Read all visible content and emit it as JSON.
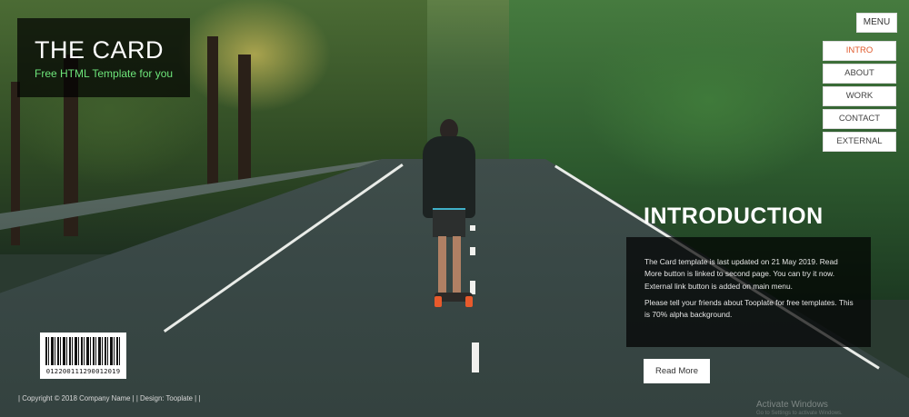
{
  "brand": {
    "title": "THE CARD",
    "subtitle": "Free HTML Template for you"
  },
  "menu": {
    "toggle_label": "MENU",
    "items": [
      {
        "label": "INTRO",
        "active": true
      },
      {
        "label": "ABOUT",
        "active": false
      },
      {
        "label": "WORK",
        "active": false
      },
      {
        "label": "CONTACT",
        "active": false
      },
      {
        "label": "EXTERNAL",
        "active": false
      }
    ]
  },
  "intro": {
    "title": "INTRODUCTION",
    "paragraph1": "The Card template is last updated on 21 May 2019. Read More button is linked to second page. You can try it now. External link button is added on main menu.",
    "paragraph2": "Please tell your friends about Tooplate for free templates. This is 70% alpha background.",
    "button_label": "Read More"
  },
  "barcode": {
    "digits": "0122001112900120​19"
  },
  "footer": {
    "text": "| Copyright © 2018 Company Name | | Design: Tooplate | |"
  },
  "watermark": {
    "title": "Activate Windows",
    "subtitle": "Go to Settings to activate Windows."
  },
  "colors": {
    "accent_green": "#6ee57a",
    "active_menu": "#e05a2c",
    "overlay": "rgba(0,0,0,0.7)"
  }
}
